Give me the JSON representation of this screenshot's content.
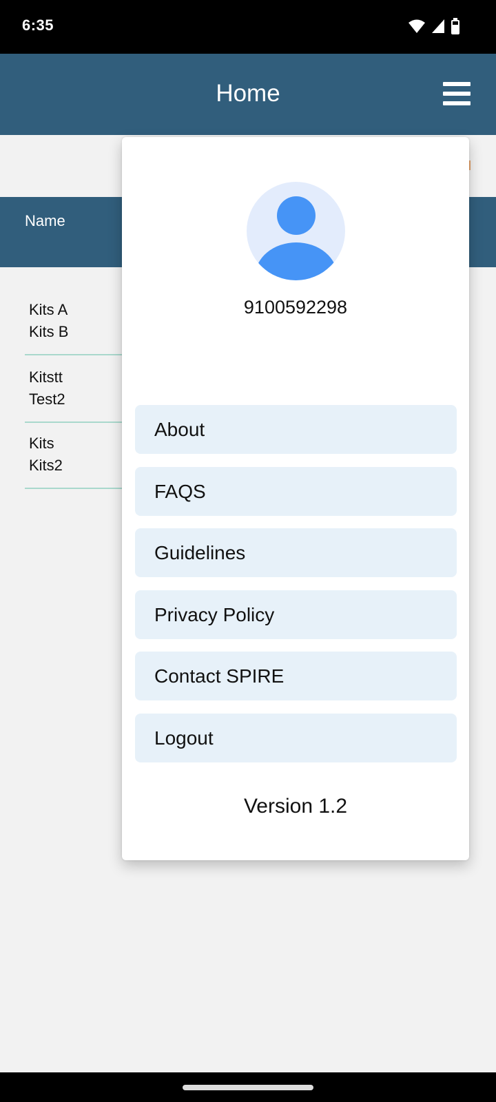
{
  "status_bar": {
    "time": "6:35",
    "icons": [
      "wifi-icon",
      "cellular-signal-icon",
      "battery-icon"
    ]
  },
  "app_bar": {
    "title": "Home",
    "menu_icon": "hamburger-menu-icon"
  },
  "table": {
    "columns": [
      "Name"
    ],
    "rows": [
      {
        "line1": "Kits A",
        "line2": "Kits B"
      },
      {
        "line1": "Kitstt",
        "line2": "Test2"
      },
      {
        "line1": "Kits",
        "line2": "Kits2"
      }
    ]
  },
  "popup_menu": {
    "avatar_icon": "user-avatar-icon",
    "phone": "9100592298",
    "items": [
      {
        "label": "About"
      },
      {
        "label": "FAQS"
      },
      {
        "label": "Guidelines"
      },
      {
        "label": "Privacy Policy"
      },
      {
        "label": "Contact SPIRE"
      },
      {
        "label": "Logout"
      }
    ],
    "version": "Version 1.2"
  },
  "colors": {
    "primary": "#315e7c",
    "menu_item_bg": "#e7f1f9",
    "avatar_blue": "#4694f6",
    "avatar_bg": "#e3ecfc",
    "row_divider": "#a9d8cc"
  }
}
